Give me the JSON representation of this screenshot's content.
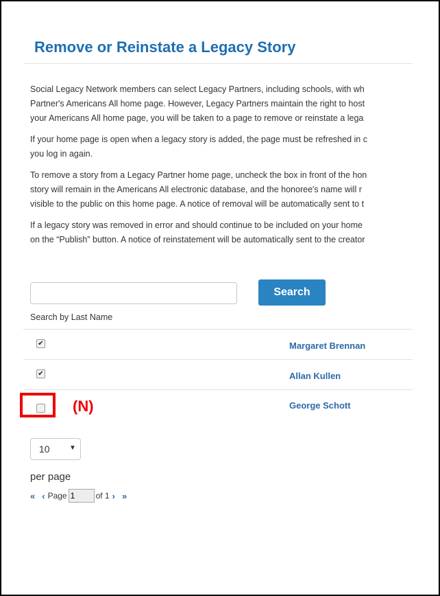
{
  "title": "Remove or Reinstate a Legacy Story",
  "paragraphs": [
    "Social Legacy Network members can select Legacy Partners, including schools, with wh",
    "Partner's Americans All home page. However, Legacy Partners maintain the right to host",
    "your Americans All home page, you will be taken to a page to remove or reinstate a lega",
    "If your home page is open when a legacy story is added, the page must be refreshed in c",
    "you log in again.",
    "To remove a story from a Legacy Partner home page, uncheck the box in front of the hon",
    "story will remain in the Americans All electronic database, and the honoree's name will r",
    "visible to the public on this home page. A notice of removal will be automatically sent to t",
    "If a legacy story was removed in error and should continue to be included on your home",
    "on the “Publish” button. A notice of reinstatement will be automatically sent to the creator"
  ],
  "search": {
    "value": "",
    "button_label": "Search",
    "hint": "Search by Last Name"
  },
  "rows": [
    {
      "checked": true,
      "name": "Margaret Brennan"
    },
    {
      "checked": true,
      "name": "Allan Kullen"
    },
    {
      "checked": false,
      "name": "George Schott"
    }
  ],
  "annotation": {
    "label": "(N)",
    "color": "#e00000"
  },
  "pagination": {
    "per_page_value": "10",
    "per_page_label": "per page",
    "first_label": "«",
    "prev_label": "‹",
    "page_word": "Page",
    "page_value": "1",
    "of_label": "of 1",
    "next_label": "›",
    "last_label": "»"
  },
  "colors": {
    "accent": "#2a84c1",
    "title": "#1f6fb2",
    "link": "#2a6aa8"
  }
}
